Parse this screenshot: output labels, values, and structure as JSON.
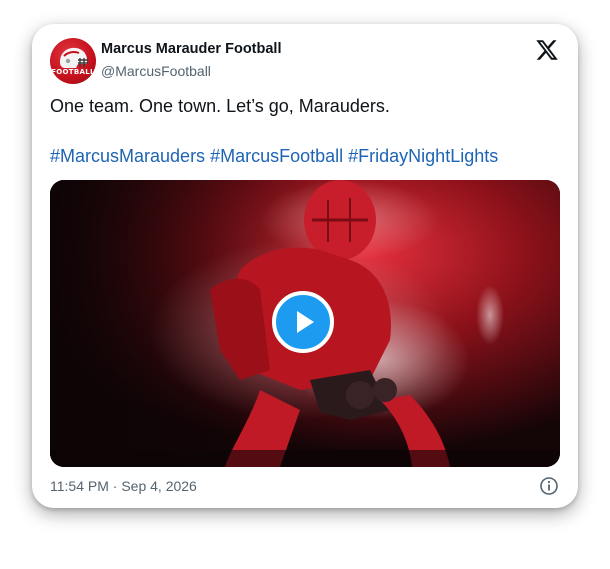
{
  "author": {
    "name": "Marcus Marauder Football",
    "handle": "@MarcusFootball",
    "avatar_text": "FOOTBALL"
  },
  "post": {
    "text": "One team. One town. Let’s go, Marauders.",
    "hashtags": [
      "#MarcusMarauders",
      "#MarcusFootball",
      "#FridayNightLights"
    ],
    "timestamp": "11:54 PM · Sep 4, 2026"
  },
  "icons": {
    "brand": "x-logo-icon",
    "play": "play-icon",
    "info": "info-icon"
  },
  "colors": {
    "accent": "#1d9bf0",
    "hashtag": "#1d64b5",
    "brand_red": "#c4111d"
  }
}
